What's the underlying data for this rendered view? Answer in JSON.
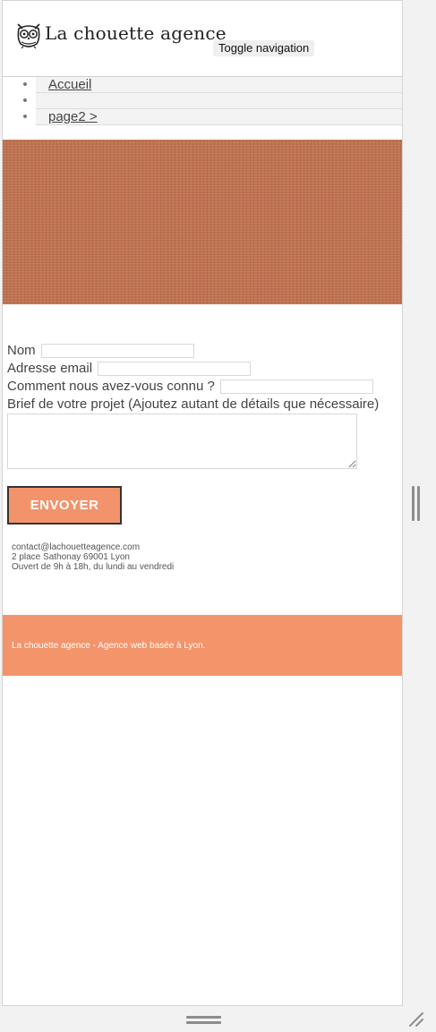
{
  "header": {
    "brand": "La chouette agence",
    "toggle_label": "Toggle navigation"
  },
  "nav": {
    "items": [
      {
        "label": "Accueil"
      },
      {
        "label": ""
      },
      {
        "label": "page2 >"
      }
    ]
  },
  "form": {
    "name_label": "Nom",
    "email_label": "Adresse email",
    "source_label": "Comment nous avez-vous connu ?",
    "brief_label": "Brief de votre projet (Ajoutez autant de détails que nécessaire)",
    "submit_label": "ENVOYER"
  },
  "contact": {
    "email": "contact@lachouetteagence.com",
    "address": "2 place Sathonay 69001 Lyon",
    "hours": "Ouvert de 9h à 18h, du lundi au vendredi"
  },
  "footer": {
    "text": "La chouette agence - Agence web basée à Lyon."
  },
  "colors": {
    "accent": "#f3946b",
    "hero": "#c3734f"
  },
  "icons": {
    "logo": "owl-logo-icon",
    "side_handle": "vertical-resize-handle-icon",
    "bottom_handle": "horizontal-resize-handle-icon",
    "corner_handle": "corner-resize-icon"
  }
}
